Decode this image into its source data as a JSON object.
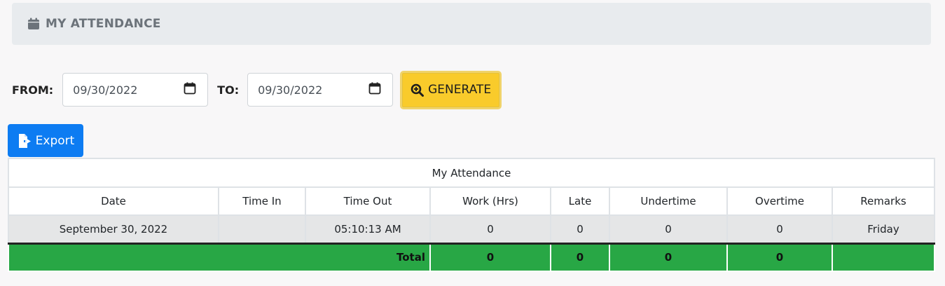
{
  "header": {
    "title": "MY ATTENDANCE",
    "icon": "calendar-icon"
  },
  "filter": {
    "from_label": "FROM:",
    "from_value": "09/30/2022",
    "to_label": "TO:",
    "to_value": "09/30/2022",
    "generate_label": "GENERATE"
  },
  "export_label": "Export",
  "table": {
    "caption": "My Attendance",
    "columns": [
      "Date",
      "Time In",
      "Time Out",
      "Work (Hrs)",
      "Late",
      "Undertime",
      "Overtime",
      "Remarks"
    ],
    "rows": [
      [
        "September 30, 2022",
        "",
        "05:10:13 AM",
        "0",
        "0",
        "0",
        "0",
        "Friday"
      ]
    ],
    "total": {
      "label": "Total",
      "work": "0",
      "late": "0",
      "undertime": "0",
      "overtime": "0"
    }
  },
  "colors": {
    "accent_yellow": "#f9cb2b",
    "primary_blue": "#0d7cf2",
    "total_green": "#28a745"
  }
}
